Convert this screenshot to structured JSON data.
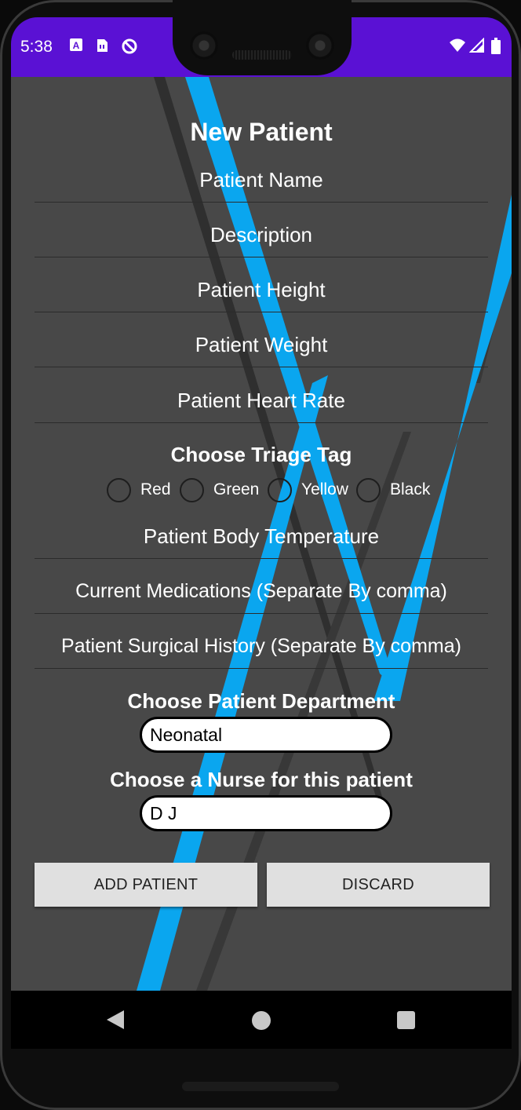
{
  "status_bar": {
    "time": "5:38",
    "icons": [
      "a-app-icon",
      "sim-card-icon",
      "sync-icon",
      "wifi-icon",
      "signal-icon",
      "battery-icon"
    ]
  },
  "form": {
    "title": "New Patient",
    "fields": [
      "Patient Name",
      "Description",
      "Patient Height",
      "Patient Weight",
      "Patient Heart Rate"
    ],
    "triage": {
      "label": "Choose Triage Tag",
      "options": [
        "Red",
        "Green",
        "Yellow",
        "Black"
      ]
    },
    "fields2": [
      "Patient Body Temperature",
      "Current Medications (Separate By comma)",
      "Patient Surgical History (Separate By comma)"
    ],
    "department": {
      "label": "Choose Patient Department",
      "selected": "Neonatal"
    },
    "nurse": {
      "label": "Choose a Nurse for this patient",
      "selected": "D J"
    },
    "buttons": {
      "add": "ADD PATIENT",
      "discard": "DISCARD"
    }
  },
  "colors": {
    "status_bar": "#5a11d4",
    "background": "#484848",
    "accent_stripe": "#0aa6ef"
  }
}
